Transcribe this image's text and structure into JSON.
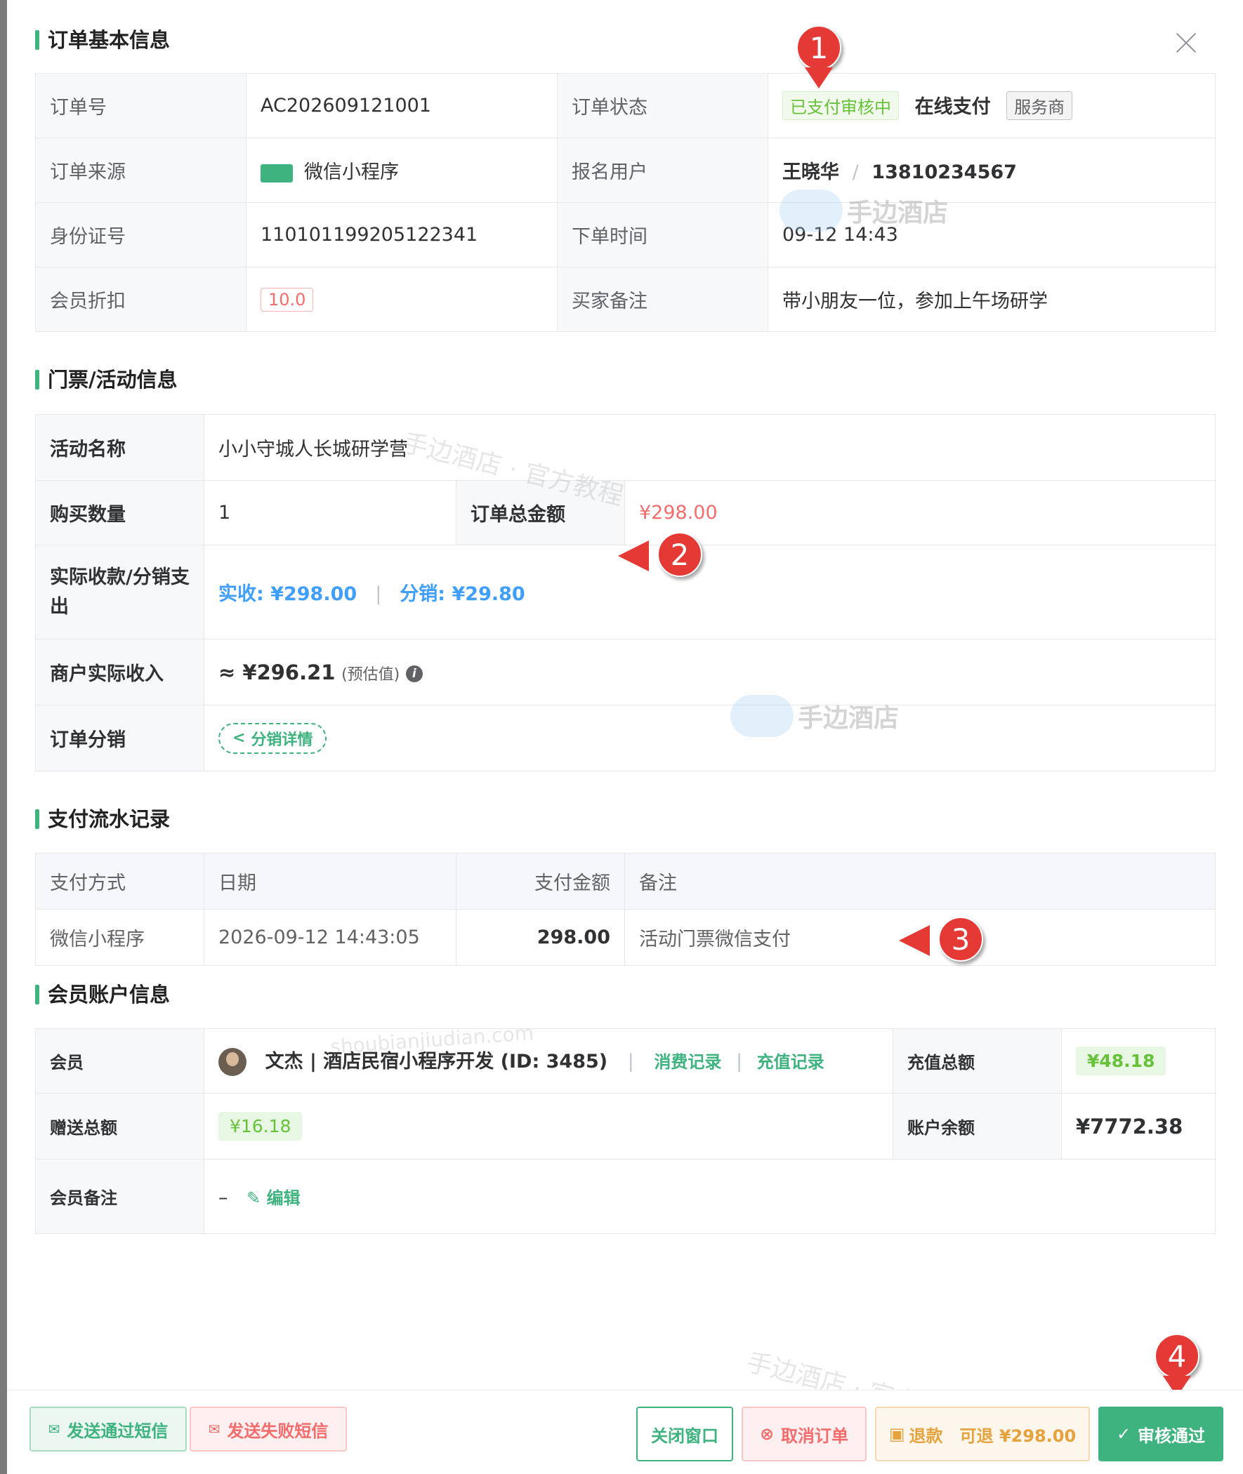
{
  "sections": {
    "basic": "订单基本信息",
    "ticket": "门票/活动信息",
    "payment": "支付流水记录",
    "member": "会员账户信息"
  },
  "basic": {
    "order_no_label": "订单号",
    "order_no": "AC202609121001",
    "status_label": "订单状态",
    "status_tag": "已支付审核中",
    "pay_type": "在线支付",
    "provider_tag": "服务商",
    "source_label": "订单来源",
    "source": "微信小程序",
    "user_label": "报名用户",
    "user_name": "王晓华",
    "user_sep": "/",
    "user_phone": "13810234567",
    "id_label": "身份证号",
    "id_no": "110101199205122341",
    "time_label": "下单时间",
    "time": "09-12 14:43",
    "discount_label": "会员折扣",
    "discount": "10.0",
    "remark_label": "买家备注",
    "remark": "带小朋友一位，参加上午场研学"
  },
  "ticket": {
    "name_label": "活动名称",
    "name": "小小守城人长城研学营",
    "qty_label": "购买数量",
    "qty": "1",
    "total_label": "订单总金额",
    "total": "¥298.00",
    "received_label": "实际收款/分销支出",
    "received": "实收: ¥298.00",
    "sep": "|",
    "commission": "分销: ¥29.80",
    "income_label": "商户实际收入",
    "income": "≈ ¥296.21",
    "income_note": "(预估值)",
    "info_icon": "i",
    "dist_label": "订单分销",
    "dist_btn": "分销详情"
  },
  "payment": {
    "headers": [
      "支付方式",
      "日期",
      "支付金额",
      "备注"
    ],
    "rows": [
      {
        "method": "微信小程序",
        "date": "2026-09-12 14:43:05",
        "amount": "298.00",
        "note": "活动门票微信支付"
      }
    ]
  },
  "member": {
    "member_label": "会员",
    "member_name": "文杰 | 酒店民宿小程序开发 (ID: 3485)",
    "consume_link": "消费记录",
    "link_sep": "|",
    "recharge_link": "充值记录",
    "recharge_total_label": "充值总额",
    "recharge_total": "¥48.18",
    "gift_label": "赠送总额",
    "gift": "¥16.18",
    "balance_label": "账户余额",
    "balance": "¥7772.38",
    "note_label": "会员备注",
    "note": "–",
    "edit": "编辑"
  },
  "footer": {
    "sms_pass": "发送通过短信",
    "sms_fail": "发送失败短信",
    "close": "关闭窗口",
    "cancel": "取消订单",
    "refund": "退款",
    "refundable": "可退 ¥298.00",
    "approve": "审核通过"
  },
  "markers": [
    "1",
    "2",
    "3",
    "4"
  ],
  "watermarks": {
    "brand": "手边酒店",
    "tutorial": "手边酒店 · 官方教程",
    "domain": "shoubianjiudian.com"
  },
  "colors": {
    "accent": "#3fb37f",
    "danger": "#f56c6c",
    "success": "#67c23a",
    "link": "#409eff",
    "marker": "#e53935"
  }
}
